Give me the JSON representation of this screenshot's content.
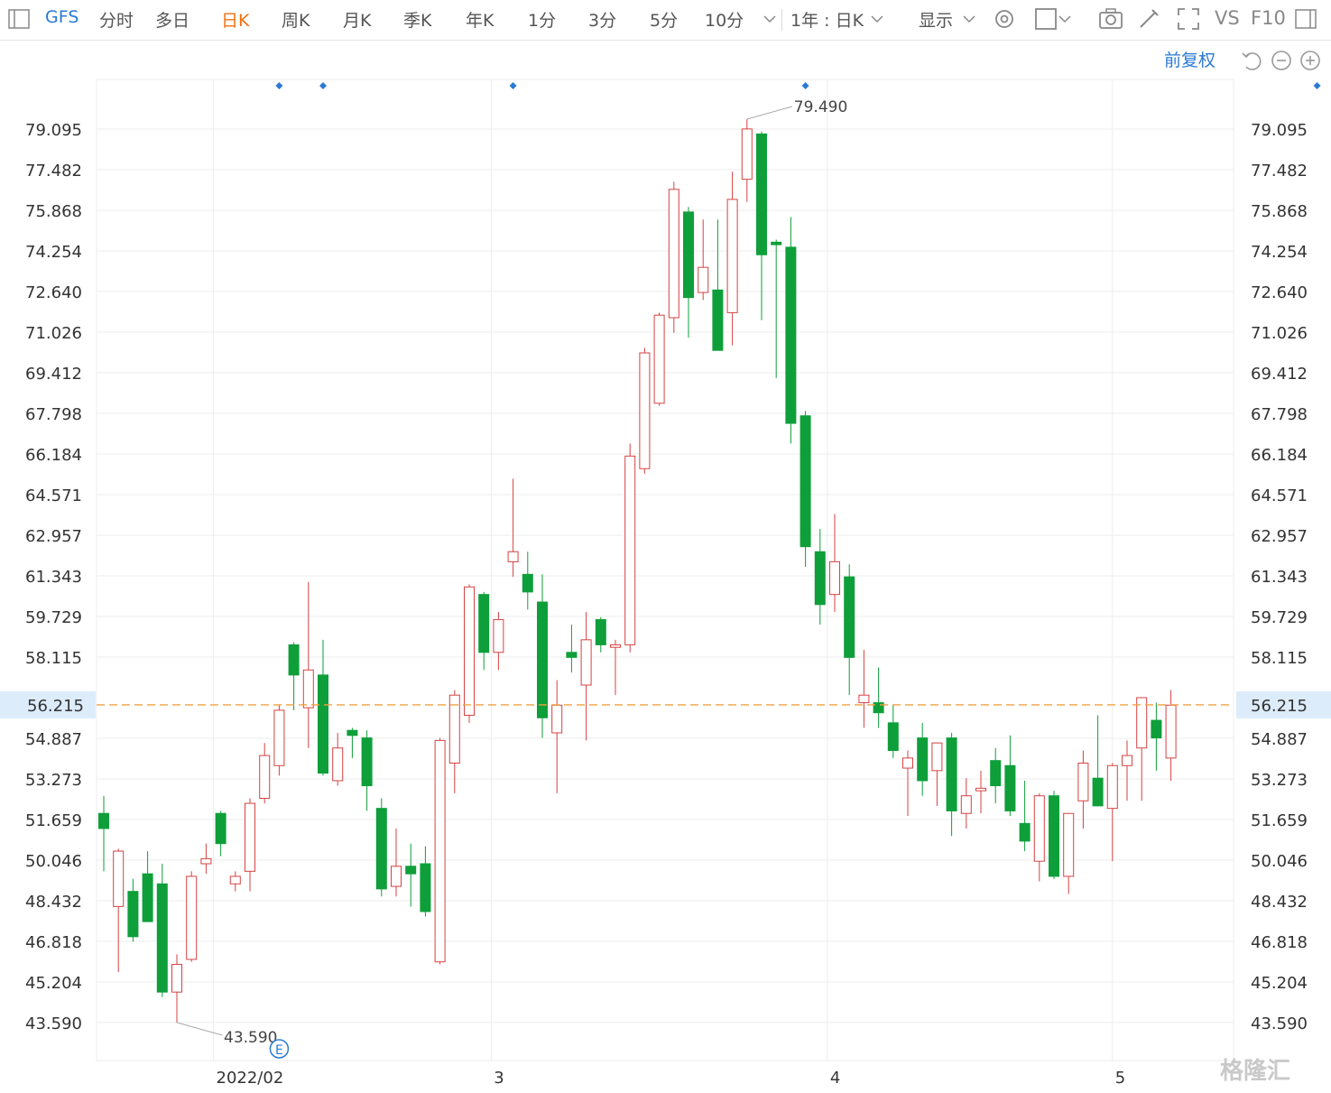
{
  "toolbar": {
    "symbol": "GFS",
    "tabs": [
      "分时",
      "多日",
      "日K",
      "周K",
      "月K",
      "季K",
      "年K",
      "1分",
      "3分",
      "5分",
      "10分"
    ],
    "active_tab": "日K",
    "period_label": "1年 : 日K",
    "display_label": "显示",
    "vs_label": "VS",
    "f10_label": "F10"
  },
  "fq_label": "前复权",
  "watermark": "格隆汇",
  "colors": {
    "up": "#d64242",
    "down": "#0e9f3a",
    "grid": "#ededed",
    "last": "#f0a040",
    "accent": "#2a7ad4"
  },
  "chart_data": {
    "type": "candlestick",
    "symbol": "GFS",
    "y_ticks": [
      "79.095",
      "77.482",
      "75.868",
      "74.254",
      "72.640",
      "71.026",
      "69.412",
      "67.798",
      "66.184",
      "64.571",
      "62.957",
      "61.343",
      "59.729",
      "58.115",
      "54.887",
      "53.273",
      "51.659",
      "50.046",
      "48.432",
      "46.818",
      "45.204",
      "43.590"
    ],
    "ylim": [
      42.0,
      81.0
    ],
    "x_labels": [
      {
        "text": "2022/02",
        "index": 7.5
      },
      {
        "text": "3",
        "index": 26.5
      },
      {
        "text": "4",
        "index": 49.5
      },
      {
        "text": "5",
        "index": 69.0
      }
    ],
    "last_price": "56.215",
    "max_label": "79.490",
    "min_label": "43.590",
    "event_marker": "E",
    "event_index": 12,
    "top_markers": [
      12,
      15,
      28,
      48,
      83
    ],
    "candles": [
      {
        "o": 51.9,
        "h": 52.6,
        "l": 49.6,
        "c": 51.3
      },
      {
        "o": 48.2,
        "h": 50.5,
        "l": 45.6,
        "c": 50.4
      },
      {
        "o": 48.8,
        "h": 49.3,
        "l": 46.8,
        "c": 47.0
      },
      {
        "o": 49.5,
        "h": 50.4,
        "l": 47.9,
        "c": 47.6
      },
      {
        "o": 49.1,
        "h": 49.9,
        "l": 44.6,
        "c": 44.8
      },
      {
        "o": 44.8,
        "h": 46.3,
        "l": 43.59,
        "c": 45.9
      },
      {
        "o": 46.1,
        "h": 49.6,
        "l": 46.0,
        "c": 49.4
      },
      {
        "o": 49.9,
        "h": 50.7,
        "l": 49.5,
        "c": 50.1
      },
      {
        "o": 51.9,
        "h": 52.0,
        "l": 50.2,
        "c": 50.7
      },
      {
        "o": 49.1,
        "h": 49.6,
        "l": 48.8,
        "c": 49.4
      },
      {
        "o": 49.6,
        "h": 52.5,
        "l": 48.8,
        "c": 52.3
      },
      {
        "o": 52.5,
        "h": 54.7,
        "l": 52.3,
        "c": 54.2
      },
      {
        "o": 53.8,
        "h": 56.2,
        "l": 53.4,
        "c": 56.0
      },
      {
        "o": 58.6,
        "h": 58.7,
        "l": 56.0,
        "c": 57.4
      },
      {
        "o": 56.1,
        "h": 61.1,
        "l": 54.5,
        "c": 57.6
      },
      {
        "o": 57.4,
        "h": 58.8,
        "l": 53.4,
        "c": 53.5
      },
      {
        "o": 53.2,
        "h": 55.1,
        "l": 53.0,
        "c": 54.5
      },
      {
        "o": 55.2,
        "h": 55.3,
        "l": 54.1,
        "c": 55.0
      },
      {
        "o": 54.9,
        "h": 55.2,
        "l": 52.0,
        "c": 53.0
      },
      {
        "o": 52.1,
        "h": 52.5,
        "l": 48.6,
        "c": 48.9
      },
      {
        "o": 49.0,
        "h": 51.3,
        "l": 48.6,
        "c": 49.8
      },
      {
        "o": 49.8,
        "h": 50.7,
        "l": 48.2,
        "c": 49.5
      },
      {
        "o": 49.9,
        "h": 50.6,
        "l": 47.8,
        "c": 48.0
      },
      {
        "o": 46.0,
        "h": 54.9,
        "l": 45.9,
        "c": 54.8
      },
      {
        "o": 53.9,
        "h": 56.8,
        "l": 52.7,
        "c": 56.6
      },
      {
        "o": 55.8,
        "h": 61.0,
        "l": 55.5,
        "c": 60.9
      },
      {
        "o": 60.6,
        "h": 60.7,
        "l": 57.6,
        "c": 58.3
      },
      {
        "o": 58.3,
        "h": 59.9,
        "l": 57.6,
        "c": 59.6
      },
      {
        "o": 61.9,
        "h": 65.2,
        "l": 61.3,
        "c": 62.3
      },
      {
        "o": 61.4,
        "h": 62.3,
        "l": 60.0,
        "c": 60.7
      },
      {
        "o": 60.3,
        "h": 61.4,
        "l": 54.9,
        "c": 55.7
      },
      {
        "o": 55.1,
        "h": 57.2,
        "l": 52.7,
        "c": 56.2
      },
      {
        "o": 58.3,
        "h": 59.4,
        "l": 57.5,
        "c": 58.1
      },
      {
        "o": 57.0,
        "h": 59.9,
        "l": 54.8,
        "c": 58.8
      },
      {
        "o": 59.6,
        "h": 59.7,
        "l": 58.3,
        "c": 58.6
      },
      {
        "o": 58.5,
        "h": 58.8,
        "l": 56.6,
        "c": 58.6
      },
      {
        "o": 58.6,
        "h": 66.6,
        "l": 58.3,
        "c": 66.1
      },
      {
        "o": 65.6,
        "h": 70.4,
        "l": 65.4,
        "c": 70.2
      },
      {
        "o": 68.2,
        "h": 71.8,
        "l": 68.1,
        "c": 71.7
      },
      {
        "o": 71.6,
        "h": 77.0,
        "l": 71.0,
        "c": 76.7
      },
      {
        "o": 75.8,
        "h": 76.0,
        "l": 70.8,
        "c": 72.4
      },
      {
        "o": 72.6,
        "h": 75.5,
        "l": 72.3,
        "c": 73.6
      },
      {
        "o": 72.7,
        "h": 75.5,
        "l": 70.6,
        "c": 70.3
      },
      {
        "o": 71.8,
        "h": 77.4,
        "l": 70.5,
        "c": 76.3
      },
      {
        "o": 77.1,
        "h": 79.49,
        "l": 76.2,
        "c": 79.1
      },
      {
        "o": 78.9,
        "h": 79.0,
        "l": 71.5,
        "c": 74.1
      },
      {
        "o": 74.6,
        "h": 74.7,
        "l": 69.2,
        "c": 74.5
      },
      {
        "o": 74.4,
        "h": 75.6,
        "l": 66.6,
        "c": 67.4
      },
      {
        "o": 67.7,
        "h": 67.9,
        "l": 61.7,
        "c": 62.5
      },
      {
        "o": 62.3,
        "h": 63.2,
        "l": 59.4,
        "c": 60.2
      },
      {
        "o": 60.6,
        "h": 63.8,
        "l": 59.9,
        "c": 61.9
      },
      {
        "o": 61.3,
        "h": 61.8,
        "l": 56.6,
        "c": 58.1
      },
      {
        "o": 56.3,
        "h": 58.4,
        "l": 55.3,
        "c": 56.6
      },
      {
        "o": 56.3,
        "h": 57.7,
        "l": 55.3,
        "c": 55.9
      },
      {
        "o": 55.5,
        "h": 56.2,
        "l": 54.1,
        "c": 54.4
      },
      {
        "o": 53.7,
        "h": 54.4,
        "l": 51.8,
        "c": 54.1
      },
      {
        "o": 54.9,
        "h": 55.5,
        "l": 52.6,
        "c": 53.2
      },
      {
        "o": 53.6,
        "h": 54.6,
        "l": 52.2,
        "c": 54.7
      },
      {
        "o": 54.9,
        "h": 55.1,
        "l": 51.0,
        "c": 52.0
      },
      {
        "o": 51.9,
        "h": 53.3,
        "l": 51.3,
        "c": 52.6
      },
      {
        "o": 52.8,
        "h": 53.6,
        "l": 51.9,
        "c": 52.9
      },
      {
        "o": 54.0,
        "h": 54.5,
        "l": 52.3,
        "c": 53.0
      },
      {
        "o": 53.8,
        "h": 55.0,
        "l": 51.8,
        "c": 52.0
      },
      {
        "o": 51.5,
        "h": 53.2,
        "l": 50.4,
        "c": 50.8
      },
      {
        "o": 50.0,
        "h": 52.7,
        "l": 49.2,
        "c": 52.6
      },
      {
        "o": 52.6,
        "h": 52.8,
        "l": 49.3,
        "c": 49.4
      },
      {
        "o": 49.4,
        "h": 51.9,
        "l": 48.7,
        "c": 51.9
      },
      {
        "o": 52.4,
        "h": 54.4,
        "l": 51.3,
        "c": 53.9
      },
      {
        "o": 53.3,
        "h": 55.8,
        "l": 52.3,
        "c": 52.2
      },
      {
        "o": 52.1,
        "h": 53.9,
        "l": 50.0,
        "c": 53.8
      },
      {
        "o": 53.8,
        "h": 54.8,
        "l": 52.4,
        "c": 54.2
      },
      {
        "o": 54.5,
        "h": 56.4,
        "l": 52.4,
        "c": 56.5
      },
      {
        "o": 55.6,
        "h": 56.3,
        "l": 53.6,
        "c": 54.9
      },
      {
        "o": 54.1,
        "h": 56.8,
        "l": 53.2,
        "c": 56.2
      }
    ]
  }
}
